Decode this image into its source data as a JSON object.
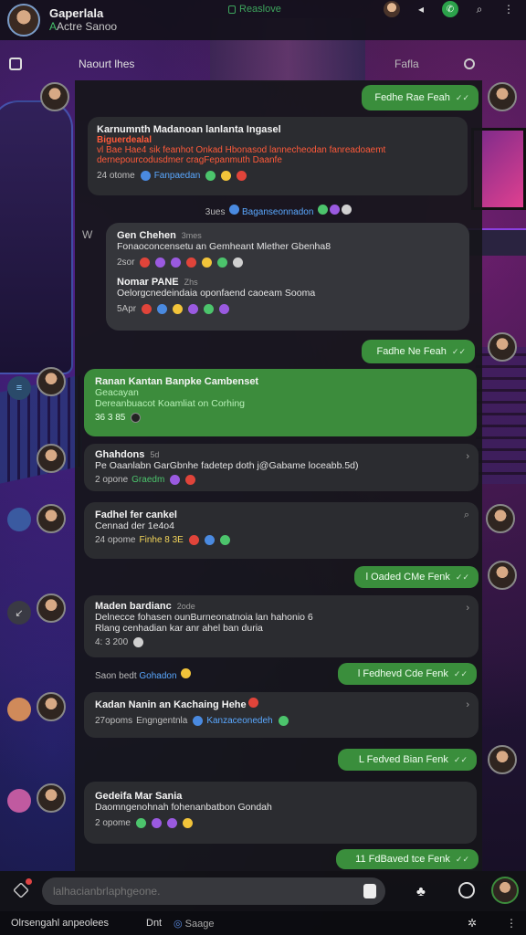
{
  "header": {
    "title": "Gaperlala",
    "subtitle": "Actre Sanoo",
    "center_status": "Reaslove"
  },
  "subheader": {
    "left_label": "Naourt lhes",
    "right_label": "Fafla"
  },
  "messages": [
    {
      "type": "out",
      "text": "Fedhe Rae Feah"
    },
    {
      "type": "card",
      "title": "Karnumnth Madanoan lanlanta Ingasel",
      "red_title": "Biguerdealal",
      "red_lines": [
        "vl Bae Hae4 sik feanhot Onkad Hbonasod lannecheodan fanreadoaemt",
        "dernepourcodusdmer cragFepanmuth Daanfe"
      ],
      "meta_time": "24 otome",
      "meta_tag": "Fanpaedan"
    },
    {
      "type": "sys",
      "time": "3ues",
      "text": "Baganseonnadon"
    },
    {
      "type": "group",
      "a_title": "Gen Chehen",
      "a_time": "3mes",
      "a_text": "Fonaoconcensetu an Gemheant Mlether Gbenha8",
      "a_meta": "2sor",
      "b_title": "Nomar PANE",
      "b_time": "Zhs",
      "b_text": "Oelorgcnedeindaia oponfaend caoeam Sooma",
      "b_meta": "5Apr"
    },
    {
      "type": "out",
      "text": "Fadhe Ne Feah"
    },
    {
      "type": "green",
      "title": "Ranan Kantan Banpke Cambenset",
      "l1": "Geacayan",
      "l2": "Dereanbuacot Koamliat on Corhing",
      "meta": "36 3 85"
    },
    {
      "type": "dark",
      "title": "Ghahdons",
      "time": "5d",
      "text": "Pe Oaanlabn GarGbnhe fadetep doth j@Gabame loceabb.5d)",
      "meta_time": "2 opone",
      "meta_tag": "Graedm"
    },
    {
      "type": "dark",
      "title": "Fadhel fer cankel",
      "text": "Cennad der 1e4o4",
      "meta_time": "24 opome",
      "meta_tag": "Finhe 8 3E"
    },
    {
      "type": "out",
      "text": "l Oaded CMe Fenk"
    },
    {
      "type": "dark",
      "title": "Maden bardianc",
      "time": "2ode",
      "l1": "Delnecce fohasen ounBurneonatnoia lan hahonio 6",
      "l2": "Rlang cenhadian kar anr ahel ban duria",
      "meta": "4: 3 200"
    },
    {
      "type": "sys2",
      "time": "Saon bedt",
      "tag": "Gohadon"
    },
    {
      "type": "out",
      "text": "l Fedhevd Cde Fenk"
    },
    {
      "type": "dark",
      "title": "Kadan Nanin an Kachaing Hehe",
      "meta_time": "27opoms",
      "meta_tag": "Engngentnla",
      "meta_tag2": "Kanzaceonedeh"
    },
    {
      "type": "out",
      "text": "L Fedved Bian Fenk"
    },
    {
      "type": "dark",
      "title": "Gedeifa Mar Sania",
      "text": "Daomngenohnah fohenanbatbon Gondah",
      "meta": "2 opome"
    },
    {
      "type": "out",
      "text": "11 FdBaved tce Fenk"
    }
  ],
  "composer": {
    "placeholder": "lalhacianbrlaphgeone."
  },
  "footer": {
    "left": "Olrsengahl anpeolees",
    "mid": "Dnt",
    "right": "Saage"
  }
}
